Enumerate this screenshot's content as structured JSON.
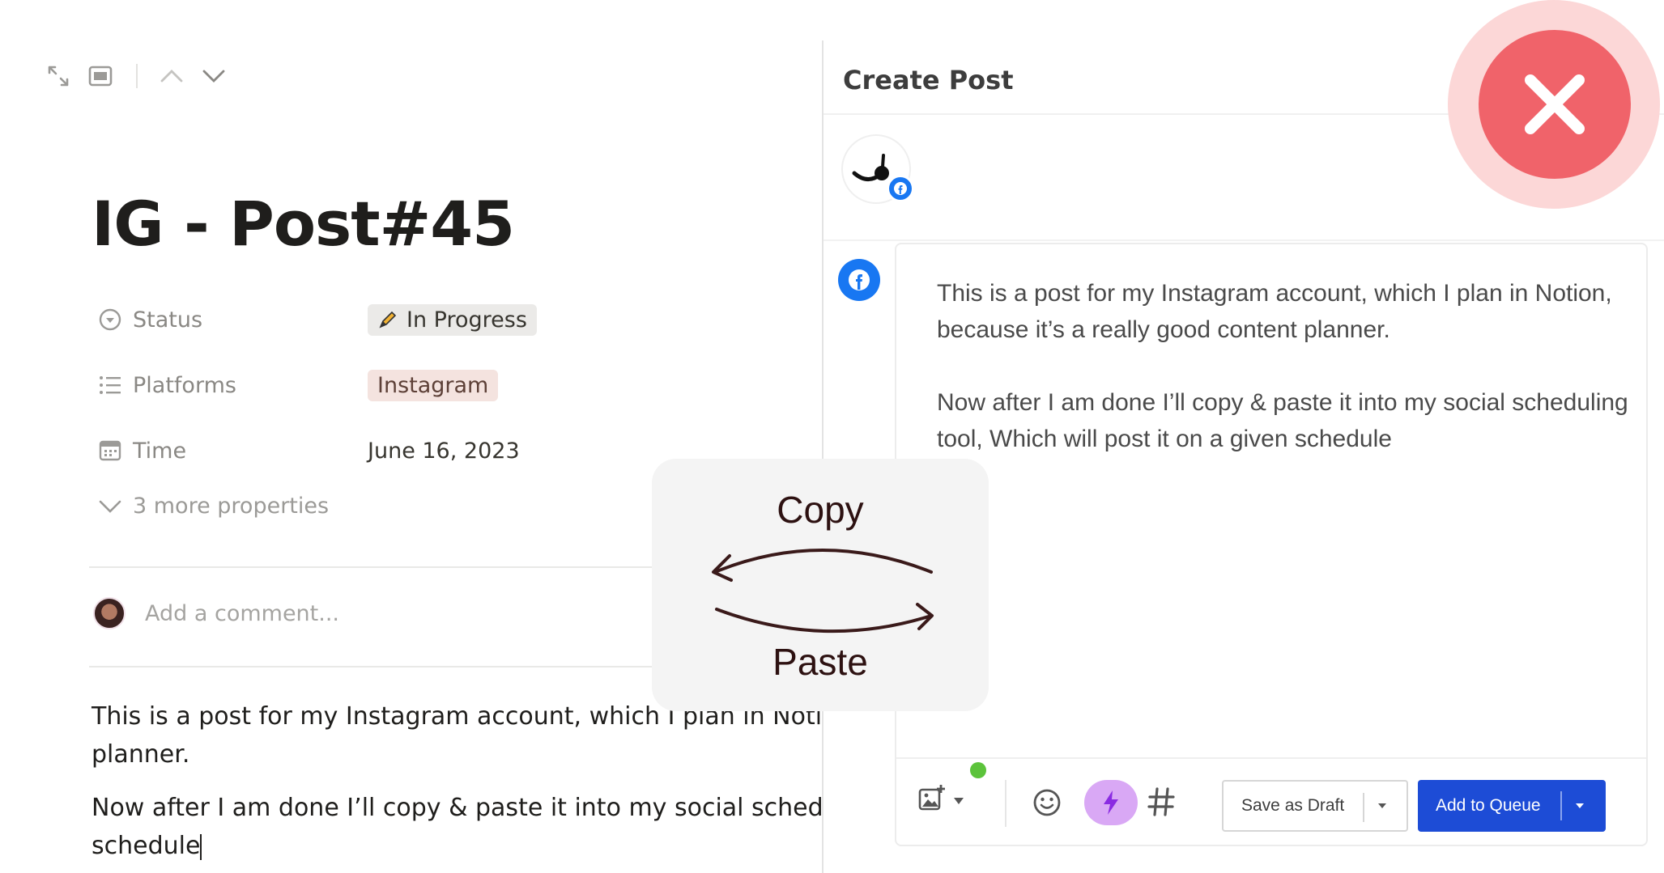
{
  "notion": {
    "toolbar": {
      "icons": [
        "expand-icon",
        "peek-mode-icon",
        "chevron-up-icon",
        "chevron-down-icon"
      ]
    },
    "title": "IG - Post#45",
    "properties": [
      {
        "icon": "status-icon",
        "name": "Status",
        "value": "In Progress",
        "value_icon": "pencil-icon"
      },
      {
        "icon": "list-icon",
        "name": "Platforms",
        "value": "Instagram"
      },
      {
        "icon": "calendar-icon",
        "name": "Time",
        "value": "June 16, 2023"
      }
    ],
    "more_properties": "3 more properties",
    "comment_placeholder": "Add a comment...",
    "body": {
      "line1": "This is a post for my Instagram account, which I plan in Notion, be",
      "line2": "planner.",
      "line3": "Now after I am done I’ll copy & paste it into my social scheduling t",
      "line4": "schedule"
    }
  },
  "buffer": {
    "title": "Create Post",
    "channel_badge": "facebook-icon",
    "post_text": {
      "p1": "This is a post for my Instagram account, which I plan in Notion, because it’s a really good content planner.",
      "p2": "Now after I am done I’ll copy & paste it into my social scheduling tool, Which will post it on a given schedule"
    },
    "toolbar": {
      "icons": [
        "image-add-icon",
        "emoji-icon",
        "lightning-icon",
        "hashtag-icon"
      ],
      "save_draft": "Save as Draft",
      "add_queue": "Add to Queue"
    },
    "colors": {
      "primary": "#1d4cd6",
      "facebook": "#1877f2",
      "ai_assist": "#d9a8f5"
    }
  },
  "overlay": {
    "copy_label": "Copy",
    "paste_label": "Paste",
    "close_color": "#f0636a"
  }
}
